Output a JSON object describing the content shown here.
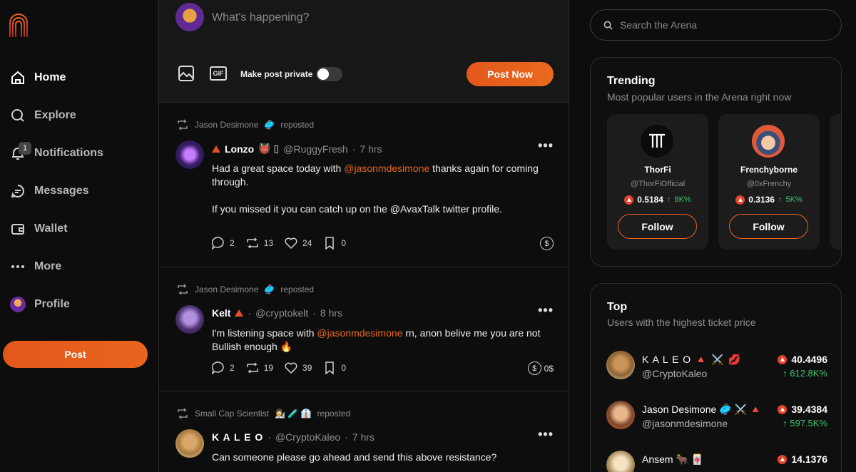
{
  "nav": {
    "home": "Home",
    "explore": "Explore",
    "notifications": "Notifications",
    "notifications_badge": "1",
    "messages": "Messages",
    "wallet": "Wallet",
    "more": "More",
    "profile": "Profile",
    "post_button": "Post"
  },
  "composer": {
    "placeholder": "What's happening?",
    "gif_label": "GIF",
    "private_label": "Make post private",
    "private_enabled": false,
    "post_now": "Post Now"
  },
  "posts": [
    {
      "repost_by": "Jason Desimone",
      "repost_emoji": "🥏",
      "repost_word": "reposted",
      "name": "Lonzo",
      "name_emoji": "👹 ▯",
      "handle": "@RuggyFresh",
      "time": "7 hrs",
      "text_1": "Had a great space today with",
      "mention": "@jasonmdesimone",
      "text_2": "thanks again for coming through.",
      "text_3": "If you missed it you can catch up on the @AvaxTalk twitter profile.",
      "comments": "2",
      "reposts": "13",
      "likes": "24",
      "bookmarks": "0"
    },
    {
      "repost_by": "Jason Desimone",
      "repost_emoji": "🥏",
      "repost_word": "reposted",
      "name": "Kelt",
      "handle": "@cryptokelt",
      "time": "8 hrs",
      "text_1": "I'm listening space with",
      "mention": "@jasonmdesimone",
      "text_2": "rn, anon belive me you are not Bullish enough 🔥",
      "comments": "2",
      "reposts": "19",
      "likes": "39",
      "bookmarks": "0",
      "tip_amount": "0$"
    },
    {
      "repost_by": "Small Cap Scientist",
      "repost_emoji": "👩‍🔬 🧪 👔",
      "repost_word": "reposted",
      "name": "K A L E O",
      "handle": "@CryptoKaleo",
      "time": "7 hrs",
      "text_1": "Can someone please go ahead and send this above resistance?"
    }
  ],
  "search": {
    "placeholder": "Search the Arena"
  },
  "trending": {
    "title": "Trending",
    "subtitle": "Most popular users in the Arena right now",
    "users": [
      {
        "name": "ThorFi",
        "handle": "@ThorFiOfficial",
        "price": "0.5184",
        "change": "8K%",
        "follow": "Follow"
      },
      {
        "name": "Frenchyborne",
        "handle": "@0xFrenchy",
        "price": "0.3136",
        "change": "5K%",
        "follow": "Follow"
      }
    ]
  },
  "top": {
    "title": "Top",
    "subtitle": "Users with the highest ticket price",
    "users": [
      {
        "name": "K A L E O 🔺 ⚔️ 💋",
        "handle": "@CryptoKaleo",
        "price": "40.4496",
        "change": "612.8K%"
      },
      {
        "name": "Jason Desimone 🥏 ⚔️ 🔺",
        "handle": "@jasonmdesimone",
        "price": "39.4384",
        "change": "597.5K%"
      },
      {
        "name": "Ansem 🐂 🀄",
        "handle": "",
        "price": "14.1376",
        "change": ""
      }
    ]
  },
  "colors": {
    "accent": "#e8651d",
    "positive": "#3ec46d",
    "arena_red": "#e8412c"
  }
}
